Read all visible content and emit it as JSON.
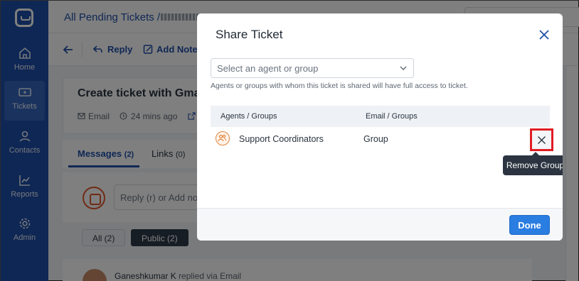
{
  "sidebar": {
    "items": [
      {
        "label": "Home",
        "icon": "home-icon"
      },
      {
        "label": "Tickets",
        "icon": "ticket-icon",
        "active": true
      },
      {
        "label": "Contacts",
        "icon": "contacts-icon"
      },
      {
        "label": "Reports",
        "icon": "reports-icon"
      },
      {
        "label": "Admin",
        "icon": "gear-icon"
      }
    ]
  },
  "header": {
    "breadcrumb": "All Pending Tickets /"
  },
  "toolbar": {
    "reply_label": "Reply",
    "add_note_label": "Add Note"
  },
  "ticket": {
    "title": "Create ticket with Gmail .",
    "source": "Email",
    "time_ago": "24 mins ago"
  },
  "tabs": [
    {
      "label": "Messages",
      "count": "(2)",
      "active": true
    },
    {
      "label": "Links",
      "count": "(0)"
    }
  ],
  "reply": {
    "placeholder": "Reply (r) or Add note"
  },
  "filters": {
    "all": "All (2)",
    "public": "Public (2)"
  },
  "message": {
    "author": "Ganeshkumar K",
    "action": "replied via Email"
  },
  "modal": {
    "title": "Share Ticket",
    "select_placeholder": "Select an agent or group",
    "hint": "Agents or groups with whom this ticket is shared will have full access to ticket.",
    "columns": {
      "col1": "Agents / Groups",
      "col2": "Email / Groups"
    },
    "rows": [
      {
        "name": "Support Coordinators",
        "type": "Group"
      }
    ],
    "tooltip": "Remove Group",
    "done_label": "Done"
  },
  "colors": {
    "sidebar": "#1f4fa8",
    "primary": "#2a7de1",
    "highlight": "#e01d25",
    "group_icon": "#e0843f"
  }
}
